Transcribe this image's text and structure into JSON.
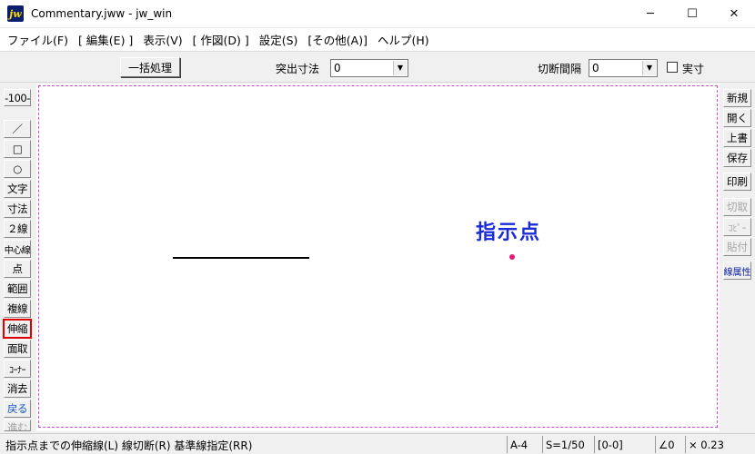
{
  "window": {
    "app_icon_text": "jw",
    "title": "Commentary.jww - jw_win",
    "minimize_glyph": "─",
    "maximize_glyph": "☐",
    "close_glyph": "✕"
  },
  "menu": {
    "items": [
      "ファイル(F)",
      "[ 編集(E) ]",
      "表示(V)",
      "[ 作図(D) ]",
      "設定(S)",
      "[その他(A)]",
      "ヘルプ(H)"
    ]
  },
  "toolbar": {
    "batch_button": "一括処理",
    "protrusion_label": "突出寸法",
    "protrusion_value": "0",
    "cut_interval_label": "切断間隔",
    "cut_interval_value": "0",
    "actual_size_label": "実寸",
    "dropdown_arrow": "▼"
  },
  "left_tools": {
    "scale_button": "-100-",
    "items": [
      {
        "label": "／",
        "name": "line-tool"
      },
      {
        "label": "□",
        "name": "rectangle-tool"
      },
      {
        "label": "○",
        "name": "circle-tool"
      },
      {
        "label": "文字",
        "name": "text-tool"
      },
      {
        "label": "寸法",
        "name": "dimension-tool"
      },
      {
        "label": "２線",
        "name": "double-line-tool"
      },
      {
        "label": "中心線",
        "name": "center-line-tool"
      },
      {
        "label": "点",
        "name": "point-tool"
      },
      {
        "label": "範囲",
        "name": "range-tool"
      },
      {
        "label": "複線",
        "name": "parallel-line-tool"
      },
      {
        "label": "伸縮",
        "name": "extend-trim-tool"
      },
      {
        "label": "面取",
        "name": "chamfer-tool"
      },
      {
        "label": "ｺｰﾅｰ",
        "name": "corner-tool"
      },
      {
        "label": "消去",
        "name": "erase-tool"
      },
      {
        "label": "戻る",
        "name": "undo-tool"
      },
      {
        "label": "進む",
        "name": "redo-tool"
      }
    ]
  },
  "right_tools": {
    "items": [
      {
        "label": "新規",
        "name": "new-button"
      },
      {
        "label": "開く",
        "name": "open-button"
      },
      {
        "label": "上書",
        "name": "overwrite-button"
      },
      {
        "label": "保存",
        "name": "save-button"
      },
      {
        "label": "印刷",
        "name": "print-button"
      },
      {
        "label": "切取",
        "name": "cut-button"
      },
      {
        "label": "ｺﾋﾟｰ",
        "name": "copy-button"
      },
      {
        "label": "貼付",
        "name": "paste-button"
      },
      {
        "label": "線属性",
        "name": "line-attribute-button"
      }
    ]
  },
  "canvas": {
    "indicator_label": "指示点",
    "indicator_dot_color": "#e0197a",
    "label_color": "#1a2bd6",
    "page_border_color": "#d14bd1"
  },
  "statusbar": {
    "message": "指示点までの伸縮線(L) 線切断(R) 基準線指定(RR)",
    "paper": "A-4",
    "scale": "S=1/50",
    "layer": "[0-0]",
    "angle": "∠0",
    "zoom": "× 0.23"
  },
  "colors": {
    "active_tool_outline": "#e00000",
    "undo_text": "#1556c4"
  }
}
